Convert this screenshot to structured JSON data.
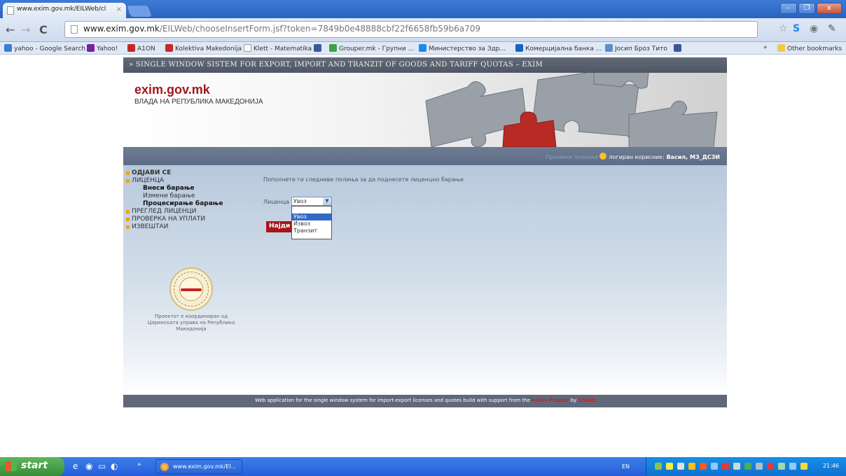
{
  "browser": {
    "tab_title": "www.exim.gov.mk/EILWeb/cl",
    "tab_close": "×",
    "url_domain": "www.exim.gov.mk",
    "url_path": "/EILWeb/chooseInsertForm.jsf?token=7849b0e48888cbf22f6658fb59b6a709",
    "window_controls": [
      "–",
      "❐",
      "x"
    ],
    "bookmarks": [
      {
        "label": "yahoo - Google Search",
        "color": "#3c7fd1"
      },
      {
        "label": "Yahoo!",
        "color": "#7b1fa2"
      },
      {
        "label": "A1ON",
        "color": "#c62828"
      },
      {
        "label": "Kolektiva Makedonija",
        "color": "#c62828"
      },
      {
        "label": "Klett - Matematika",
        "color": "#9e9e9e"
      },
      {
        "label": "",
        "color": "#3b5998"
      },
      {
        "label": "Grouper.mk - Групни ...",
        "color": "#43a047"
      },
      {
        "label": "Министерство за Здр...",
        "color": "#1e88e5"
      },
      {
        "label": "Комерцијална банка ...",
        "color": "#1565c0"
      },
      {
        "label": "Јосип Броз Тито",
        "color": "#5d8fc7"
      },
      {
        "label": "",
        "color": "#3b5998"
      }
    ],
    "other_bookmarks": "Other bookmarks",
    "chevron": "»"
  },
  "page": {
    "header_strip": "» SINGLE WINDOW SISTEM FOR EXPORT, IMPORT AND TRANZIT OF GOODS AND TARIFF QUOTAS – EXIM",
    "logo": "exim.gov.mk",
    "sublogo": "ВЛАДА НА РЕПУБЛИКА МАКЕДОНИЈА",
    "user_prefix": "Промени лозинка",
    "user_label": "логиран корисник: ",
    "user_name": "Васил, МЗ_ДСЗИ",
    "menu": [
      {
        "label": "ОДЈАВИ СЕ",
        "level": 1,
        "bold": true
      },
      {
        "label": "ЛИЦЕНЦА",
        "level": 1,
        "bold": false
      },
      {
        "label": "Внеси барање",
        "level": 2,
        "bold": true
      },
      {
        "label": "Измени барање",
        "level": 2,
        "bold": false
      },
      {
        "label": "Процесирање барање",
        "level": 2,
        "bold": true
      },
      {
        "label": "ПРЕГЛЕД ЛИЦЕНЦИ",
        "level": 1,
        "bold": false
      },
      {
        "label": "ПРОВЕРКА НА УПЛАТИ",
        "level": 1,
        "bold": false
      },
      {
        "label": "ИЗВЕШТАИ",
        "level": 1,
        "bold": false
      }
    ],
    "prompt": "Пополнете ги следниве полиња за да поднесете лиценцно барање",
    "field_label": "Лиценца",
    "select_value": "Увоз",
    "options": [
      "",
      "Увоз",
      "Извоз",
      "Транзит"
    ],
    "find_button": "Најди",
    "seal_text": "Проектот е координиран од Царинската управа на Република Македонија",
    "footer_text": "Web application for the single window system for import-export licenses and quotes build with support from the",
    "footer_project": "e-Gov Project",
    "footer_by": "by",
    "footer_usaid": "USAID"
  },
  "taskbar": {
    "start": "start",
    "task_label": "www.exim.gov.mk/EI...",
    "lang": "EN",
    "clock": "21:46"
  }
}
